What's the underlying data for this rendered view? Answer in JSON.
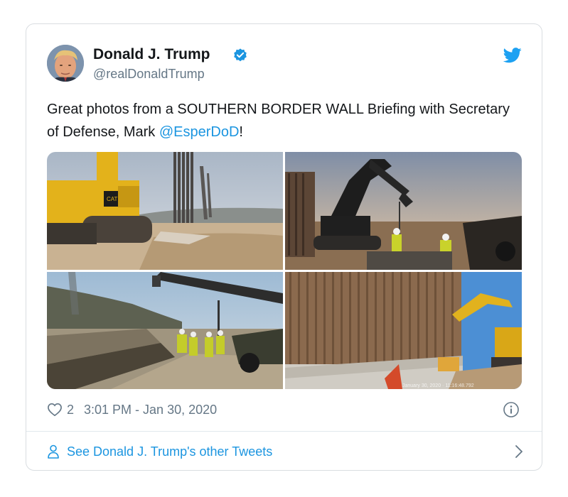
{
  "tweet": {
    "author_name": "Donald J. Trump",
    "author_handle": "@realDonaldTrump",
    "text_before": "Great photos from a SOUTHERN BORDER WALL Briefing with Secretary of Defense, Mark ",
    "mention": "@EsperDoD",
    "text_after": "!",
    "likes": "2",
    "timestamp": "3:01 PM - Jan 30, 2020",
    "footer_link": "See Donald J. Trump's other Tweets",
    "photo_watermark": "January 30, 2020 · 11:16:48.792"
  },
  "icons": {
    "verified": "verified-badge-icon",
    "bird": "twitter-bird-icon",
    "heart": "heart-icon",
    "info": "info-icon",
    "person": "person-icon",
    "chevron": "chevron-right-icon"
  },
  "colors": {
    "accent": "#1b95e0",
    "text": "#14171a",
    "muted": "#657786",
    "border": "#d9dde1"
  }
}
